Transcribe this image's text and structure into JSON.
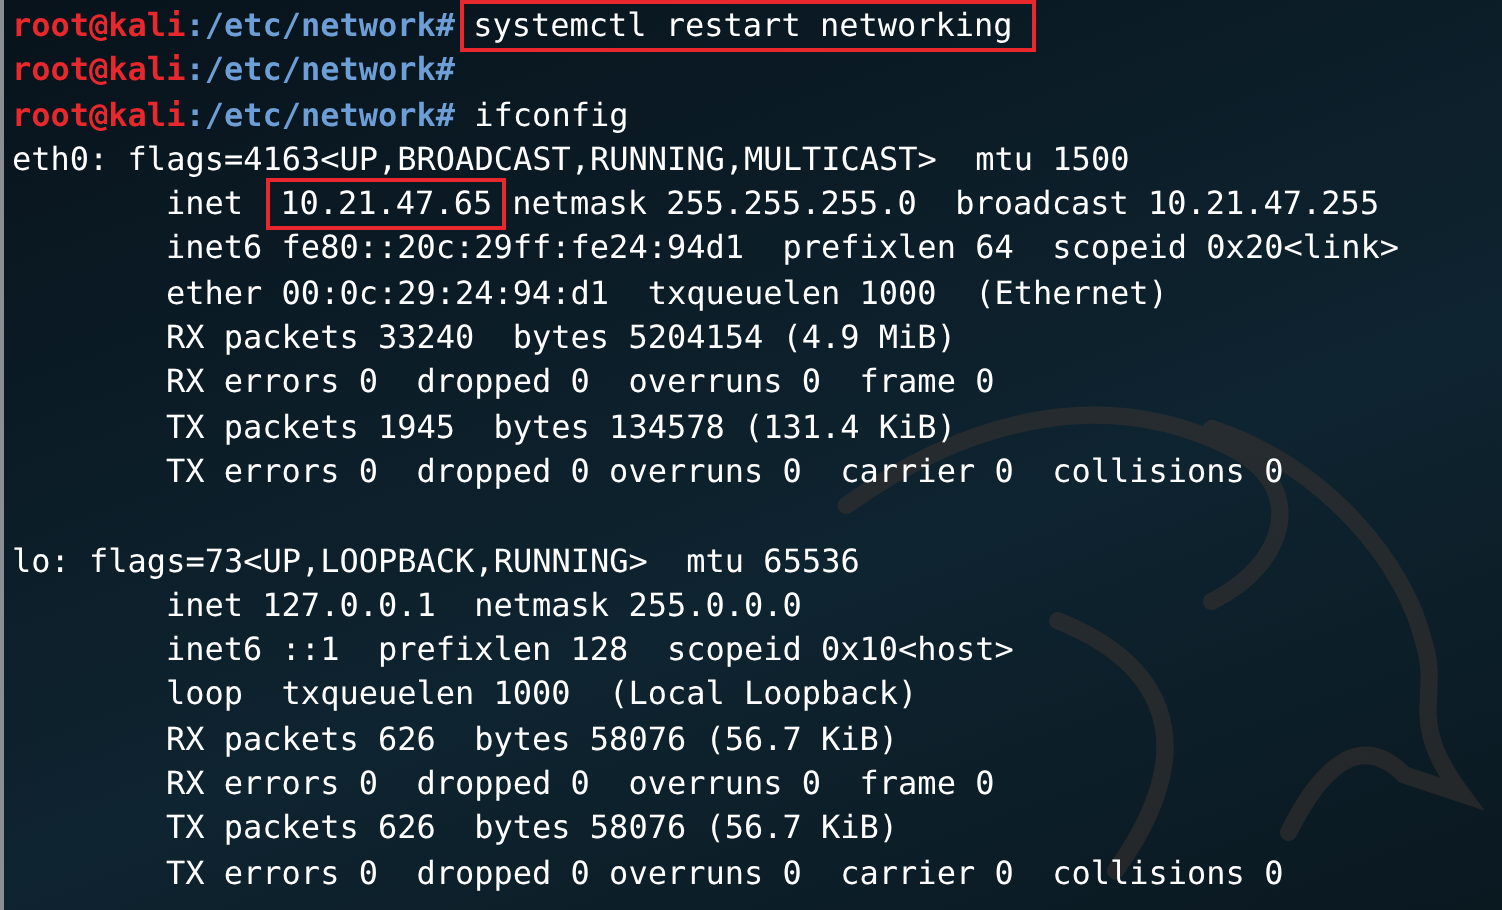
{
  "terminal": {
    "lines": [
      {
        "kind": "prompt",
        "user": "root@kali",
        "path": ":/etc/network",
        "symbol": "#",
        "command": "systemctl restart networking",
        "highlighted": true
      },
      {
        "kind": "prompt",
        "user": "root@kali",
        "path": ":/etc/network",
        "symbol": "#"
      },
      {
        "kind": "prompt",
        "user": "root@kali",
        "path": ":/etc/network",
        "symbol": "#",
        "command": "ifconfig",
        "highlighted": false
      },
      {
        "kind": "header",
        "segments": [
          {
            "text": "eth0: flags=4163<UP,BROADCAST,RUNNING,MULTICAST>  mtu 1500",
            "highlighted": false
          }
        ]
      },
      {
        "kind": "output",
        "segments": [
          {
            "text": "inet",
            "highlighted": false
          },
          {
            "text": "10.21.47.65",
            "highlighted": true
          },
          {
            "text": "netmask 255.255.255.0  broadcast 10.21.47.255",
            "highlighted": false
          }
        ]
      },
      {
        "kind": "output",
        "segments": [
          {
            "text": "inet6 fe80::20c:29ff:fe24:94d1  prefixlen 64  scopeid 0x20<link>",
            "highlighted": false
          }
        ]
      },
      {
        "kind": "output",
        "segments": [
          {
            "text": "ether 00:0c:29:24:94:d1  txqueuelen 1000  (Ethernet)",
            "highlighted": false
          }
        ]
      },
      {
        "kind": "output",
        "segments": [
          {
            "text": "RX packets 33240  bytes 5204154 (4.9 MiB)",
            "highlighted": false
          }
        ]
      },
      {
        "kind": "output",
        "segments": [
          {
            "text": "RX errors 0  dropped 0  overruns 0  frame 0",
            "highlighted": false
          }
        ]
      },
      {
        "kind": "output",
        "segments": [
          {
            "text": "TX packets 1945  bytes 134578 (131.4 KiB)",
            "highlighted": false
          }
        ]
      },
      {
        "kind": "output",
        "segments": [
          {
            "text": "TX errors 0  dropped 0 overruns 0  carrier 0  collisions 0",
            "highlighted": false
          }
        ]
      },
      {
        "kind": "blank"
      },
      {
        "kind": "header",
        "segments": [
          {
            "text": "lo: flags=73<UP,LOOPBACK,RUNNING>  mtu 65536",
            "highlighted": false
          }
        ]
      },
      {
        "kind": "output",
        "segments": [
          {
            "text": "inet 127.0.0.1  netmask 255.0.0.0",
            "highlighted": false
          }
        ]
      },
      {
        "kind": "output",
        "segments": [
          {
            "text": "inet6 ::1  prefixlen 128  scopeid 0x10<host>",
            "highlighted": false
          }
        ]
      },
      {
        "kind": "output",
        "segments": [
          {
            "text": "loop  txqueuelen 1000  (Local Loopback)",
            "highlighted": false
          }
        ]
      },
      {
        "kind": "output",
        "segments": [
          {
            "text": "RX packets 626  bytes 58076 (56.7 KiB)",
            "highlighted": false
          }
        ]
      },
      {
        "kind": "output",
        "segments": [
          {
            "text": "RX errors 0  dropped 0  overruns 0  frame 0",
            "highlighted": false
          }
        ]
      },
      {
        "kind": "output",
        "segments": [
          {
            "text": "TX packets 626  bytes 58076 (56.7 KiB)",
            "highlighted": false
          }
        ]
      },
      {
        "kind": "output",
        "segments": [
          {
            "text": "TX errors 0  dropped 0 overruns 0  carrier 0  collisions 0",
            "highlighted": false
          }
        ]
      }
    ]
  }
}
